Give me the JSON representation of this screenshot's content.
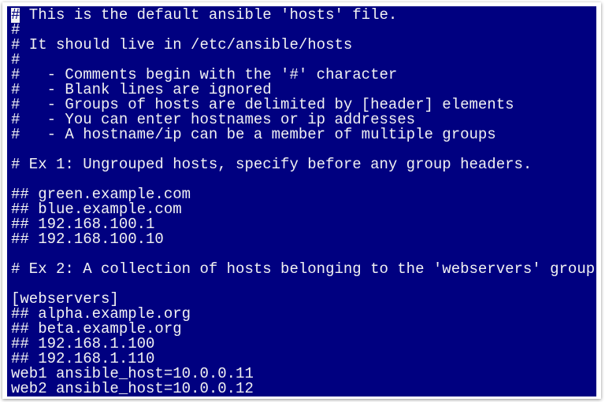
{
  "terminal": {
    "background": "#000080",
    "foreground": "#f2f2f2",
    "cursor_char": "#",
    "lines": [
      "# This is the default ansible 'hosts' file.",
      "#",
      "# It should live in /etc/ansible/hosts",
      "#",
      "#   - Comments begin with the '#' character",
      "#   - Blank lines are ignored",
      "#   - Groups of hosts are delimited by [header] elements",
      "#   - You can enter hostnames or ip addresses",
      "#   - A hostname/ip can be a member of multiple groups",
      "",
      "# Ex 1: Ungrouped hosts, specify before any group headers.",
      "",
      "## green.example.com",
      "## blue.example.com",
      "## 192.168.100.1",
      "## 192.168.100.10",
      "",
      "# Ex 2: A collection of hosts belonging to the 'webservers' group",
      "",
      "[webservers]",
      "## alpha.example.org",
      "## beta.example.org",
      "## 192.168.1.100",
      "## 192.168.1.110",
      "web1 ansible_host=10.0.0.11",
      "web2 ansible_host=10.0.0.12"
    ]
  }
}
